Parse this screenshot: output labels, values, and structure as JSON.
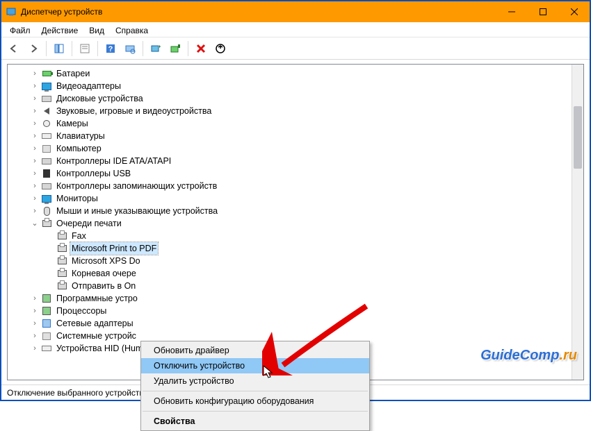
{
  "window": {
    "title": "Диспетчер устройств"
  },
  "menu": {
    "file": "Файл",
    "action": "Действие",
    "view": "Вид",
    "help": "Справка"
  },
  "tree": {
    "items": [
      {
        "label": "Батареи",
        "icon": "battery-icon"
      },
      {
        "label": "Видеоадаптеры",
        "icon": "monitor-icon"
      },
      {
        "label": "Дисковые устройства",
        "icon": "drive-icon"
      },
      {
        "label": "Звуковые, игровые и видеоустройства",
        "icon": "sound-icon"
      },
      {
        "label": "Камеры",
        "icon": "camera-icon"
      },
      {
        "label": "Клавиатуры",
        "icon": "keyboard-icon"
      },
      {
        "label": "Компьютер",
        "icon": "computer-icon"
      },
      {
        "label": "Контроллеры IDE ATA/ATAPI",
        "icon": "drive-icon"
      },
      {
        "label": "Контроллеры USB",
        "icon": "usb-icon"
      },
      {
        "label": "Контроллеры запоминающих устройств",
        "icon": "drive-icon"
      },
      {
        "label": "Мониторы",
        "icon": "monitor-icon"
      },
      {
        "label": "Мыши и иные указывающие устройства",
        "icon": "mouse-icon"
      },
      {
        "label": "Очереди печати",
        "icon": "printer-icon",
        "expanded": true,
        "children": [
          {
            "label": "Fax",
            "icon": "printer-icon"
          },
          {
            "label": "Microsoft Print to PDF",
            "icon": "printer-icon",
            "selected": true
          },
          {
            "label": "Microsoft XPS Do",
            "icon": "printer-icon"
          },
          {
            "label": "Корневая очере",
            "icon": "printer-icon"
          },
          {
            "label": "Отправить в On",
            "icon": "printer-icon"
          }
        ]
      },
      {
        "label": "Программные устро",
        "icon": "chip-icon"
      },
      {
        "label": "Процессоры",
        "icon": "chip-icon"
      },
      {
        "label": "Сетевые адаптеры",
        "icon": "network-icon"
      },
      {
        "label": "Системные устройс",
        "icon": "computer-icon"
      },
      {
        "label": "Устройства HID (Human Interface Devices)",
        "icon": "keyboard-icon"
      }
    ]
  },
  "contextmenu": {
    "items": [
      {
        "label": "Обновить драйвер"
      },
      {
        "label": "Отключить устройство",
        "highlighted": true
      },
      {
        "label": "Удалить устройство"
      }
    ],
    "items2": [
      {
        "label": "Обновить конфигурацию оборудования"
      }
    ],
    "items3": [
      {
        "label": "Свойства",
        "bold": true
      }
    ]
  },
  "statusbar": {
    "text": "Отключение выбранного устройства."
  },
  "watermark": {
    "brand": "Guide",
    "brand2": "Comp",
    "tld": ".ru"
  }
}
